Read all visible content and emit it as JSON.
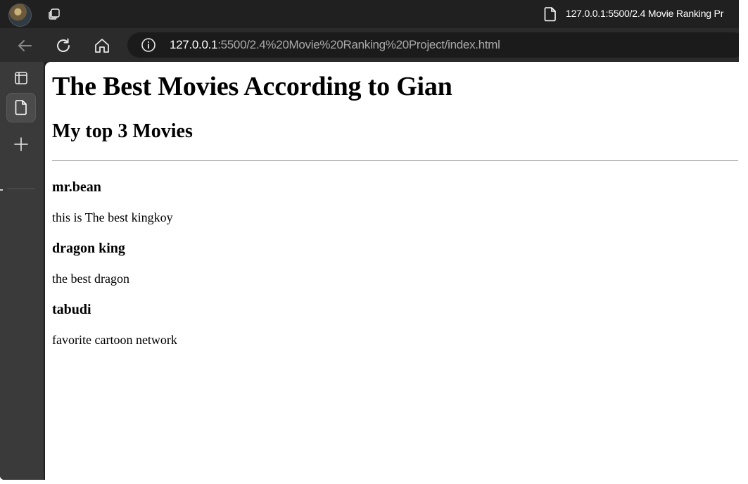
{
  "browser": {
    "tab_title": "127.0.0.1:5500/2.4 Movie Ranking Pr",
    "url_host": "127.0.0.1",
    "url_rest": ":5500/2.4%20Movie%20Ranking%20Project/index.html",
    "icons": [
      "profile-avatar",
      "tabs-icon",
      "document-icon",
      "back-arrow-icon",
      "reload-icon",
      "home-icon",
      "info-icon",
      "vertical-tabs-icon",
      "page-icon",
      "plus-icon"
    ]
  },
  "page": {
    "title": "The Best Movies According to Gian",
    "subtitle": "My top 3 Movies",
    "movies": [
      {
        "name": "mr.bean",
        "description": "this is The best kingkoy"
      },
      {
        "name": "dragon king",
        "description": "the best dragon"
      },
      {
        "name": "tabudi",
        "description": "favorite cartoon network"
      }
    ]
  }
}
